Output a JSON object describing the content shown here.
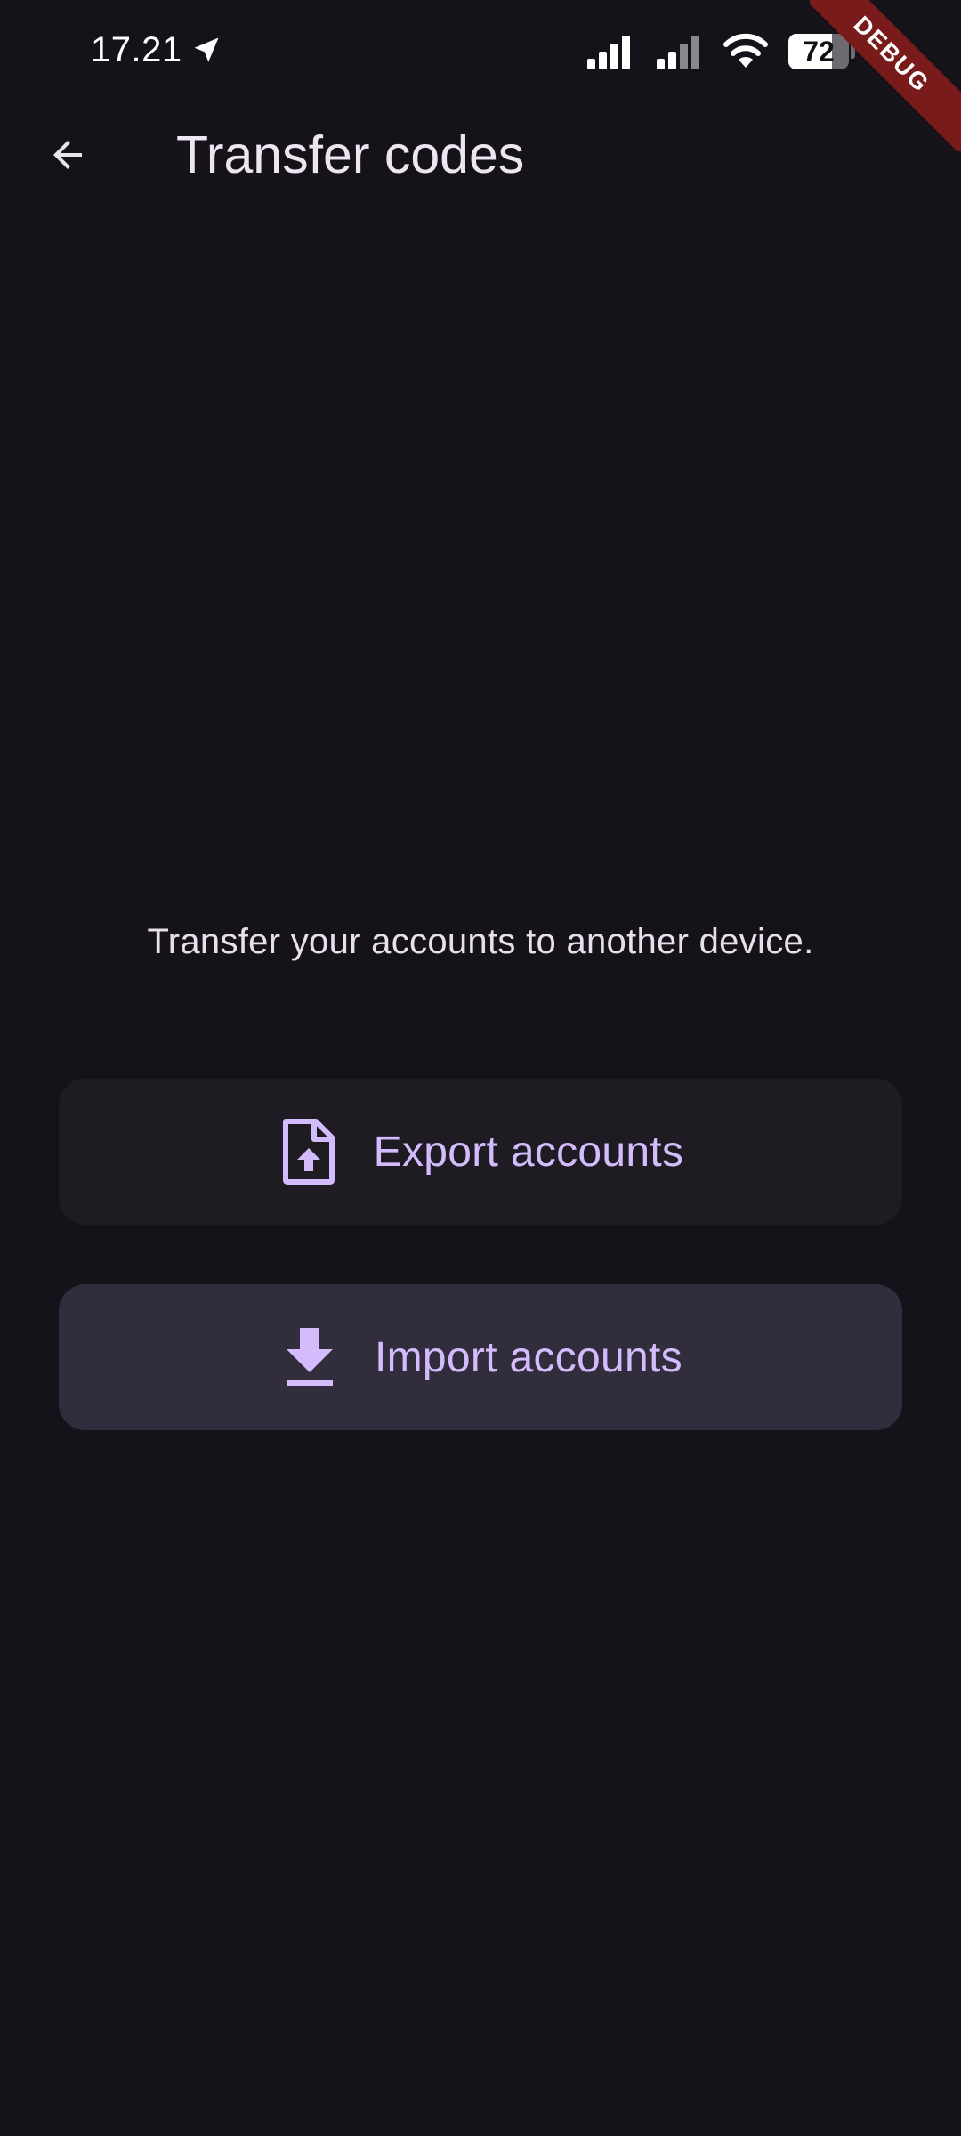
{
  "status_bar": {
    "time": "17.21",
    "battery_level": "72",
    "battery_fraction": 0.72
  },
  "debug_banner": {
    "label": "DEBUG"
  },
  "app_bar": {
    "title": "Transfer codes"
  },
  "main": {
    "description": "Transfer your accounts to another device.",
    "export_label": "Export accounts",
    "import_label": "Import accounts"
  },
  "colors": {
    "background": "#15121a",
    "accent": "#d4bbfc",
    "export_button_bg": "#1e1b22",
    "import_button_bg": "#322d3c",
    "debug_ribbon": "#7a1b1b"
  },
  "icons": {
    "back": "arrow-back-icon",
    "export": "file-upload-icon",
    "import": "download-icon",
    "location": "location-arrow-icon",
    "signal1": "signal-icon",
    "signal2": "signal-icon",
    "wifi": "wifi-icon",
    "battery": "battery-icon"
  }
}
